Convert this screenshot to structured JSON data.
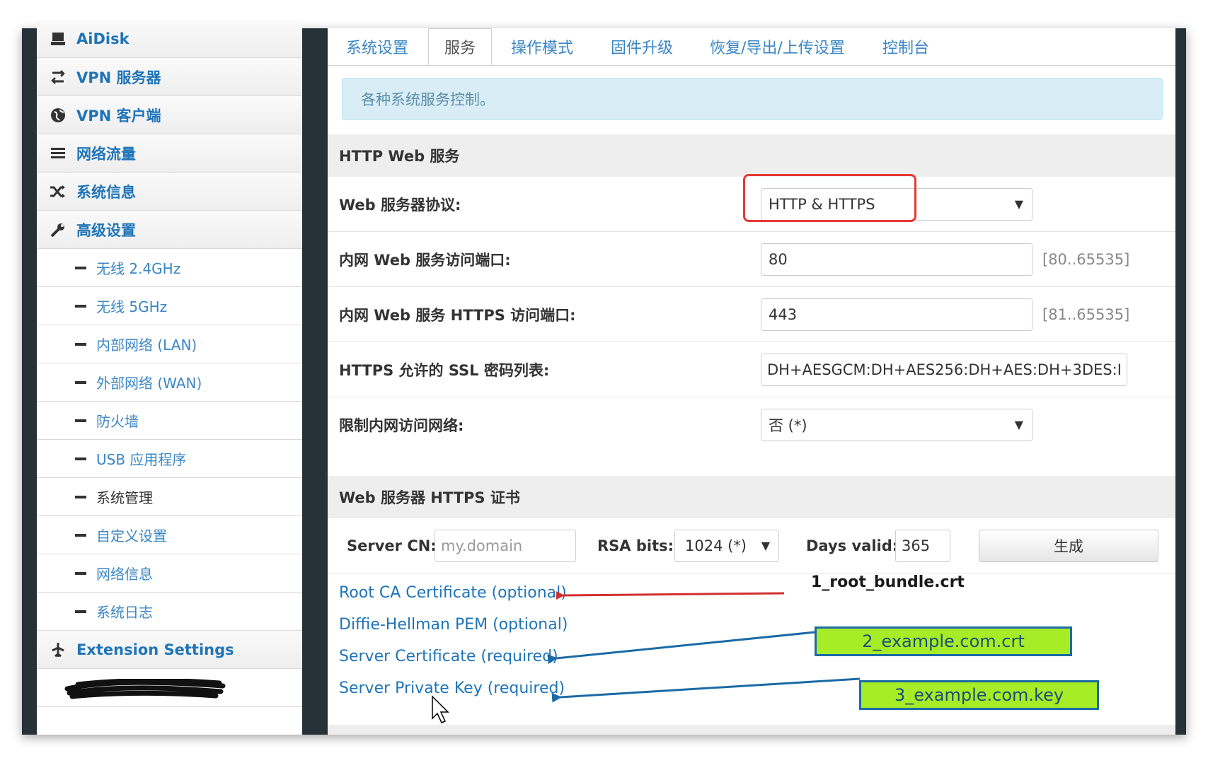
{
  "sidebar": {
    "items": [
      {
        "label": "AiDisk",
        "icon": "hdd-icon",
        "type": "main"
      },
      {
        "label": "VPN 服务器",
        "icon": "vpn-server-icon",
        "type": "main"
      },
      {
        "label": "VPN 客户端",
        "icon": "globe-icon",
        "type": "main"
      },
      {
        "label": "网络流量",
        "icon": "list-icon",
        "type": "main"
      },
      {
        "label": "系统信息",
        "icon": "shuffle-icon",
        "type": "main"
      },
      {
        "label": "高级设置",
        "icon": "wrench-icon",
        "type": "main"
      },
      {
        "label": "无线 2.4GHz",
        "type": "sub"
      },
      {
        "label": "无线 5GHz",
        "type": "sub"
      },
      {
        "label": "内部网络 (LAN)",
        "type": "sub"
      },
      {
        "label": "外部网络 (WAN)",
        "type": "sub"
      },
      {
        "label": "防火墙",
        "type": "sub"
      },
      {
        "label": "USB 应用程序",
        "type": "sub"
      },
      {
        "label": "系统管理",
        "type": "sub",
        "active": true
      },
      {
        "label": "自定义设置",
        "type": "sub"
      },
      {
        "label": "网络信息",
        "type": "sub"
      },
      {
        "label": "系统日志",
        "type": "sub"
      },
      {
        "label": "Extension Settings",
        "icon": "plane-icon",
        "type": "main"
      }
    ]
  },
  "tabs": [
    {
      "label": "系统设置"
    },
    {
      "label": "服务",
      "active": true
    },
    {
      "label": "操作模式"
    },
    {
      "label": "固件升级"
    },
    {
      "label": "恢复/导出/上传设置"
    },
    {
      "label": "控制台"
    }
  ],
  "info": "各种系统服务控制。",
  "http_section": {
    "title": "HTTP Web 服务",
    "protocol_label": "Web 服务器协议:",
    "protocol_value": "HTTP & HTTPS",
    "http_port_label": "内网 Web 服务访问端口:",
    "http_port_value": "80",
    "http_port_hint": "[80..65535]",
    "https_port_label": "内网 Web 服务 HTTPS 访问端口:",
    "https_port_value": "443",
    "https_port_hint": "[81..65535]",
    "ssl_label": "HTTPS 允许的 SSL 密码列表:",
    "ssl_value": "DH+AESGCM:DH+AES256:DH+AES:DH+3DES:I",
    "restrict_label": "限制内网访问网络:",
    "restrict_value": "否 (*)"
  },
  "cert_section": {
    "title": "Web 服务器 HTTPS 证书",
    "cn_label": "Server CN:",
    "cn_placeholder": "my.domain",
    "rsa_label": "RSA bits:",
    "rsa_value": "1024 (*)",
    "days_label": "Days valid:",
    "days_value": "365",
    "generate_label": "生成",
    "links": [
      "Root CA Certificate (optional)",
      "Diffie-Hellman PEM (optional)",
      "Server Certificate (required)",
      "Server Private Key (required)"
    ]
  },
  "annotations": {
    "root_bundle": "1_root_bundle.crt",
    "example_crt": "2_example.com.crt",
    "example_key": "3_example.com.key",
    "callout_color": "#a6ec27",
    "arrow_red": "#d32f2f",
    "arrow_blue": "#1b6aa5"
  }
}
